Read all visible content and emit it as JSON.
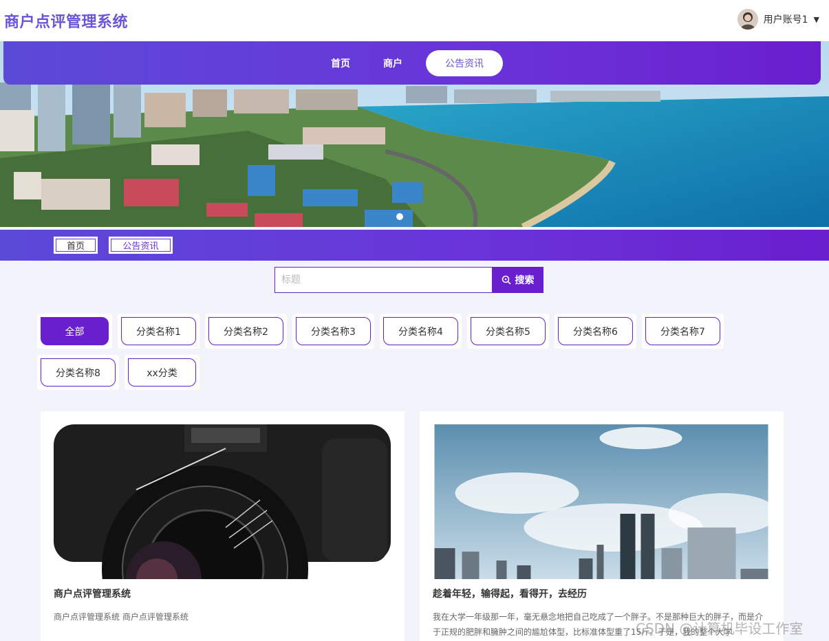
{
  "header": {
    "title": "商户点评管理系统",
    "user_label": "用户账号1"
  },
  "nav": {
    "items": [
      {
        "label": "首页"
      },
      {
        "label": "商户"
      },
      {
        "label": "公告资讯"
      }
    ],
    "active_index": 2
  },
  "breadcrumb": {
    "home": "首页",
    "current": "公告资讯"
  },
  "search": {
    "placeholder": "标题",
    "value": "",
    "button_label": "搜索"
  },
  "categories": {
    "items": [
      "全部",
      "分类名称1",
      "分类名称2",
      "分类名称3",
      "分类名称4",
      "分类名称5",
      "分类名称6",
      "分类名称7",
      "分类名称8",
      "xx分类"
    ],
    "active_index": 0
  },
  "news": [
    {
      "title": "商户点评管理系统",
      "desc": "商户点评管理系统 商户点评管理系统"
    },
    {
      "title": "趁着年轻，输得起，看得开，去经历",
      "desc": "我在大学一年级那一年，毫无悬念地把自己吃成了一个胖子。不是那种巨大的胖子，而是介于正规的肥胖和臃肿之间的尴尬体型，比标准体型重了15斤。于是，我的整个大学"
    }
  ],
  "watermark": "CSDN @计算机毕设工作室",
  "colors": {
    "primary": "#6a1fcf",
    "title": "#6a55d6",
    "gradient_start": "#5b4ad8"
  }
}
